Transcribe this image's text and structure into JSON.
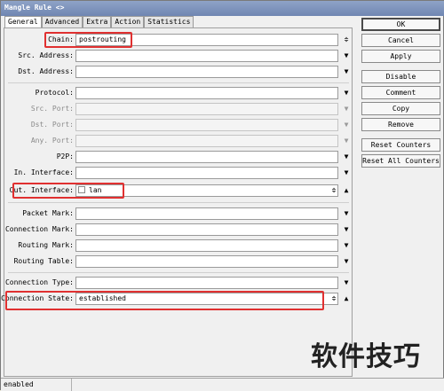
{
  "window": {
    "title": "Mangle Rule <>"
  },
  "tabs": [
    "General",
    "Advanced",
    "Extra",
    "Action",
    "Statistics"
  ],
  "fields": {
    "chain": {
      "label": "Chain:",
      "value": "postrouting"
    },
    "src_address": {
      "label": "Src. Address:",
      "value": ""
    },
    "dst_address": {
      "label": "Dst. Address:",
      "value": ""
    },
    "protocol": {
      "label": "Protocol:",
      "value": ""
    },
    "src_port": {
      "label": "Src. Port:",
      "value": ""
    },
    "dst_port": {
      "label": "Dst. Port:",
      "value": ""
    },
    "any_port": {
      "label": "Any. Port:",
      "value": ""
    },
    "p2p": {
      "label": "P2P:",
      "value": ""
    },
    "in_interface": {
      "label": "In. Interface:",
      "value": ""
    },
    "out_interface": {
      "label": "Out. Interface:",
      "value": "lan"
    },
    "packet_mark": {
      "label": "Packet Mark:",
      "value": ""
    },
    "connection_mark": {
      "label": "Connection Mark:",
      "value": ""
    },
    "routing_mark": {
      "label": "Routing Mark:",
      "value": ""
    },
    "routing_table": {
      "label": "Routing Table:",
      "value": ""
    },
    "connection_type": {
      "label": "Connection Type:",
      "value": ""
    },
    "connection_state": {
      "label": "Connection State:",
      "value": "established"
    }
  },
  "buttons": {
    "ok": "OK",
    "cancel": "Cancel",
    "apply": "Apply",
    "disable": "Disable",
    "comment": "Comment",
    "copy": "Copy",
    "remove": "Remove",
    "reset_counters": "Reset Counters",
    "reset_all_counters": "Reset All Counters"
  },
  "statusbar": {
    "state": "enabled"
  },
  "watermark": {
    "text": "软件技巧"
  },
  "icons": {
    "dropdown": "▼",
    "expand_up": "▲",
    "toggle": "≑"
  }
}
